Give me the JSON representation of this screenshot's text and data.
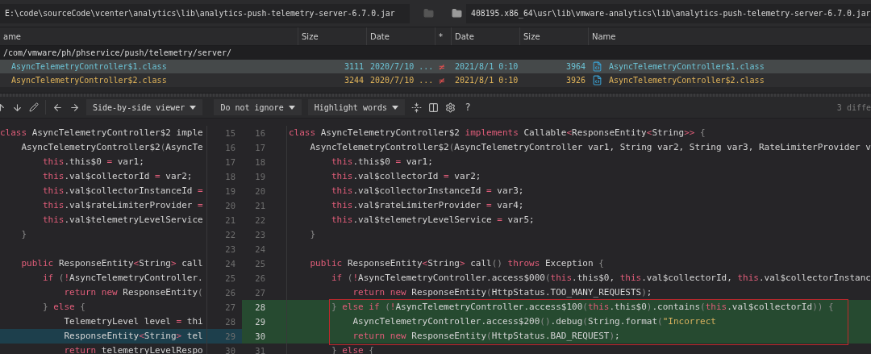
{
  "left_path": "E:\\code\\sourceCode\\vcenter\\analytics\\lib\\analytics-push-telemetry-server-6.7.0.jar",
  "right_path": "408195.x86_64\\usr\\lib\\vmware-analytics\\lib\\analytics-push-telemetry-server-6.7.0.jar",
  "columns_left": [
    "ame",
    "Size",
    "Date"
  ],
  "marker_column": "*",
  "columns_right": [
    "Date",
    "Size",
    "Name"
  ],
  "folder_row": "/com/vmware/ph/phservice/push/telemetry/server/",
  "files": [
    {
      "left_name": "AsyncTelemetryController$1.class",
      "left_size": "3111",
      "left_date": "2020/7/10 ...",
      "diff_mark": "≠",
      "right_date": "2021/8/1 0:10",
      "right_size": "3964",
      "right_name": "AsyncTelemetryController$1.class",
      "selected": true
    },
    {
      "left_name": "AsyncTelemetryController$2.class",
      "left_size": "3244",
      "left_date": "2020/7/10 ...",
      "diff_mark": "≠",
      "right_date": "2021/8/1 0:10",
      "right_size": "3926",
      "right_name": "AsyncTelemetryController$2.class",
      "selected": false
    }
  ],
  "toolbar": {
    "dropdowns": [
      "Side-by-side viewer",
      "Do not ignore",
      "Highlight words"
    ],
    "help": "?",
    "summary": "3 diffe"
  },
  "rows": [
    {
      "left_num": "15",
      "left_code": "class AsyncTelemetryController$2 imple",
      "left_changed": false,
      "right_num": "16",
      "right_code": "class AsyncTelemetryController$2 implements Callable<ResponseEntity<String>> {",
      "right_changed": false,
      "boxed": false
    },
    {
      "left_num": "16",
      "left_code": "    AsyncTelemetryController$2(AsyncTe",
      "left_changed": false,
      "right_num": "17",
      "right_code": "    AsyncTelemetryController$2(AsyncTelemetryController var1, String var2, String var3, RateLimiterProvider v",
      "right_changed": false,
      "boxed": false
    },
    {
      "left_num": "17",
      "left_code": "        this.this$0 = var1;",
      "left_changed": false,
      "right_num": "18",
      "right_code": "        this.this$0 = var1;",
      "right_changed": false,
      "boxed": false
    },
    {
      "left_num": "18",
      "left_code": "        this.val$collectorId = var2;",
      "left_changed": false,
      "right_num": "19",
      "right_code": "        this.val$collectorId = var2;",
      "right_changed": false,
      "boxed": false
    },
    {
      "left_num": "19",
      "left_code": "        this.val$collectorInstanceId =",
      "left_changed": false,
      "right_num": "20",
      "right_code": "        this.val$collectorInstanceId = var3;",
      "right_changed": false,
      "boxed": false
    },
    {
      "left_num": "20",
      "left_code": "        this.val$rateLimiterProvider =",
      "left_changed": false,
      "right_num": "21",
      "right_code": "        this.val$rateLimiterProvider = var4;",
      "right_changed": false,
      "boxed": false
    },
    {
      "left_num": "21",
      "left_code": "        this.val$telemetryLevelService",
      "left_changed": false,
      "right_num": "22",
      "right_code": "        this.val$telemetryLevelService = var5;",
      "right_changed": false,
      "boxed": false
    },
    {
      "left_num": "22",
      "left_code": "    }",
      "left_changed": false,
      "right_num": "23",
      "right_code": "    }",
      "right_changed": false,
      "boxed": false
    },
    {
      "left_num": "23",
      "left_changed": false,
      "right_num": "24",
      "right_changed": false,
      "boxed": false
    },
    {
      "left_num": "24",
      "left_code": "    public ResponseEntity<String> call",
      "left_changed": false,
      "right_num": "25",
      "right_code": "    public ResponseEntity<String> call() throws Exception {",
      "right_changed": false,
      "boxed": false
    },
    {
      "left_num": "25",
      "left_code": "        if (!AsyncTelemetryController.",
      "left_changed": false,
      "right_num": "26",
      "right_code": "        if (!AsyncTelemetryController.access$000(this.this$0, this.val$collectorId, this.val$collectorInstanc",
      "right_changed": false,
      "boxed": false
    },
    {
      "left_num": "26",
      "left_code": "            return new ResponseEntity(",
      "left_changed": false,
      "right_num": "27",
      "right_code": "            return new ResponseEntity(HttpStatus.TOO_MANY_REQUESTS);",
      "right_changed": false,
      "boxed": false
    },
    {
      "left_num": "27",
      "left_code": "        } else {",
      "left_changed": false,
      "right_num": "28",
      "right_code": "        } else if (!AsyncTelemetryController.access$100(this.this$0).contains(this.val$collectorId)) {",
      "right_changed": true,
      "boxed": true
    },
    {
      "left_num": "28",
      "left_code": "            TelemetryLevel level = thi",
      "left_changed": false,
      "right_num": "29",
      "right_code": "            AsyncTelemetryController.access$200().debug(String.format(\"Incorrect",
      "right_changed": true,
      "boxed": true
    },
    {
      "left_num": "29",
      "left_code": "            ResponseEntity<String> tel",
      "left_changed": true,
      "right_num": "30",
      "right_code": "            return new ResponseEntity(HttpStatus.BAD_REQUEST);",
      "right_changed": true,
      "boxed": true
    },
    {
      "left_num": "30",
      "left_code": "            return telemetryLevelRespo",
      "left_changed": false,
      "right_num": "31",
      "right_code": "        } else {",
      "right_changed": false,
      "boxed": false
    }
  ]
}
